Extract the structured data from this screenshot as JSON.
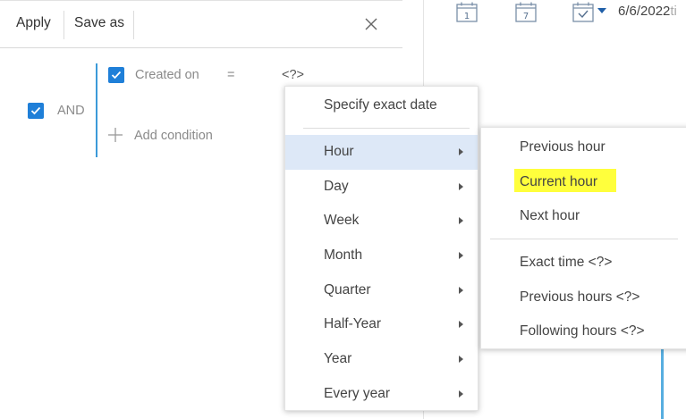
{
  "toolbar": {
    "apply_label": "Apply",
    "save_as_label": "Save as"
  },
  "filter": {
    "group_operator": "AND",
    "condition": {
      "column": "Created on",
      "operator": "=",
      "value": "<?>"
    },
    "add_condition_label": "Add condition"
  },
  "date_menu": {
    "exact_label": "Specify exact date",
    "items": [
      {
        "label": "Hour",
        "active": true
      },
      {
        "label": "Day"
      },
      {
        "label": "Week"
      },
      {
        "label": "Month"
      },
      {
        "label": "Quarter"
      },
      {
        "label": "Half-Year"
      },
      {
        "label": "Year"
      },
      {
        "label": "Every year"
      }
    ]
  },
  "hour_submenu": {
    "items": [
      {
        "label": "Previous hour"
      },
      {
        "label": "Current hour",
        "highlighted": true
      },
      {
        "label": "Next hour"
      },
      {
        "label": "Exact time <?>"
      },
      {
        "label": "Previous hours <?>"
      },
      {
        "label": "Following hours <?>"
      }
    ]
  },
  "calendar": {
    "day_icon_number": "1",
    "week_icon_number": "7",
    "date_value": "6/6/2022",
    "date_suffix": "ti"
  },
  "colors": {
    "accent": "#1f7fd8",
    "group_line": "#3b9ad9",
    "active_menu_bg": "#dde8f7",
    "highlight": "#ffff3c"
  }
}
